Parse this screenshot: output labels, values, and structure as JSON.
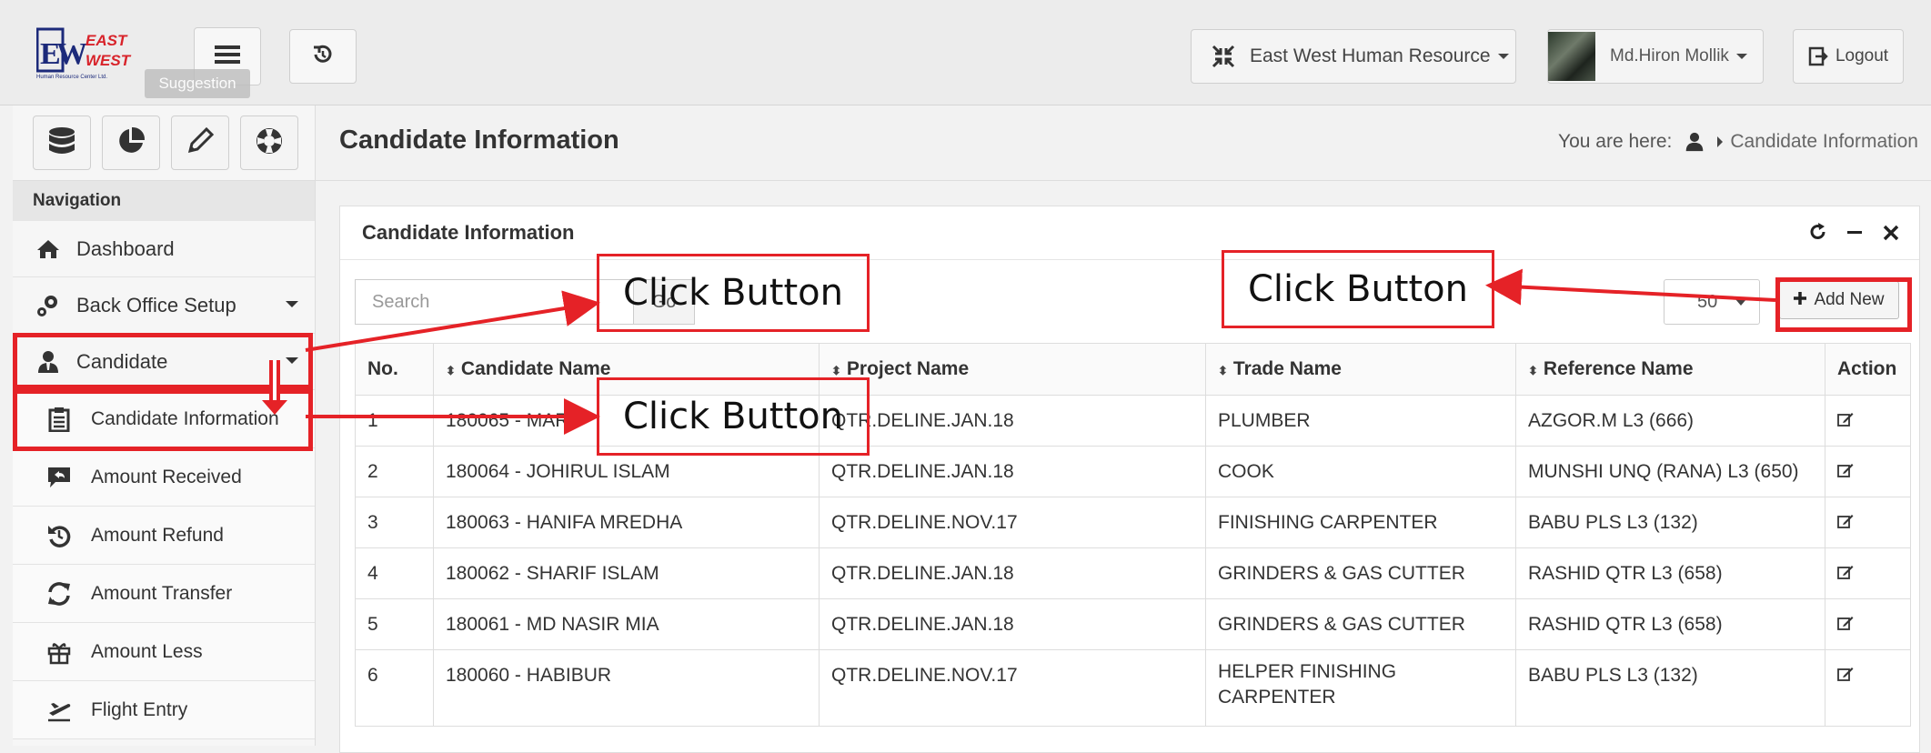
{
  "header": {
    "logo_text": "EW EAST WEST",
    "logo_subtext": "Human Resource Center Ltd.",
    "company_dropdown": "East West Human Resource",
    "user_dropdown": "Md.Hiron Mollik",
    "logout_label": "Logout",
    "tooltip": "Suggestion",
    "icons": [
      "hamburger-icon",
      "history-icon",
      "compress-icon"
    ]
  },
  "sidebar": {
    "tools": [
      "database-icon",
      "pie-chart-icon",
      "pencil-icon",
      "lifebuoy-icon"
    ],
    "nav_title": "Navigation",
    "items": [
      {
        "label": "Dashboard",
        "icon": "home-icon"
      },
      {
        "label": "Back Office Setup",
        "icon": "gears-icon"
      },
      {
        "label": "Candidate",
        "icon": "user-tie-icon"
      }
    ],
    "sub_items": [
      {
        "label": "Candidate Information",
        "icon": "clipboard-icon"
      },
      {
        "label": "Amount Received",
        "icon": "reply-bubble-icon"
      },
      {
        "label": "Amount Refund",
        "icon": "undo-icon"
      },
      {
        "label": "Amount Transfer",
        "icon": "refresh-icon"
      },
      {
        "label": "Amount Less",
        "icon": "gift-icon"
      },
      {
        "label": "Flight Entry",
        "icon": "plane-departure-icon"
      }
    ]
  },
  "page": {
    "title": "Candidate Information",
    "breadcrumb_prefix": "You are here:",
    "breadcrumb_current": "Candidate Information"
  },
  "panel": {
    "title": "Candidate Information",
    "search_placeholder": "Search",
    "search_button": "Go",
    "page_size": "50",
    "add_new": "Add New",
    "columns": [
      "No.",
      "Candidate Name",
      "Project Name",
      "Trade Name",
      "Reference Name",
      "Action"
    ],
    "rows": [
      [
        "1",
        "180065 - MARU",
        "QTR.DELINE.JAN.18",
        "PLUMBER",
        "AZGOR.M L3 (666)"
      ],
      [
        "2",
        "180064 - JOHIRUL ISLAM",
        "QTR.DELINE.JAN.18",
        "COOK",
        "MUNSHI UNQ (RANA) L3 (650)"
      ],
      [
        "3",
        "180063 - HANIFA MREDHA",
        "QTR.DELINE.NOV.17",
        "FINISHING CARPENTER",
        "BABU PLS L3 (132)"
      ],
      [
        "4",
        "180062 - SHARIF ISLAM",
        "QTR.DELINE.JAN.18",
        "GRINDERS & GAS CUTTER",
        "RASHID QTR L3 (658)"
      ],
      [
        "5",
        "180061 - MD NASIR MIA",
        "QTR.DELINE.JAN.18",
        "GRINDERS & GAS CUTTER",
        "RASHID QTR L3 (658)"
      ],
      [
        "6",
        "180060 - HABIBUR",
        "QTR.DELINE.NOV.17",
        "HELPER FINISHING CARPENTER",
        "BABU PLS L3 (132)"
      ]
    ]
  },
  "annotations": {
    "callout_1": "Click Button",
    "callout_2": "Click Button",
    "callout_3": "Click Button",
    "color": "#e52227"
  }
}
